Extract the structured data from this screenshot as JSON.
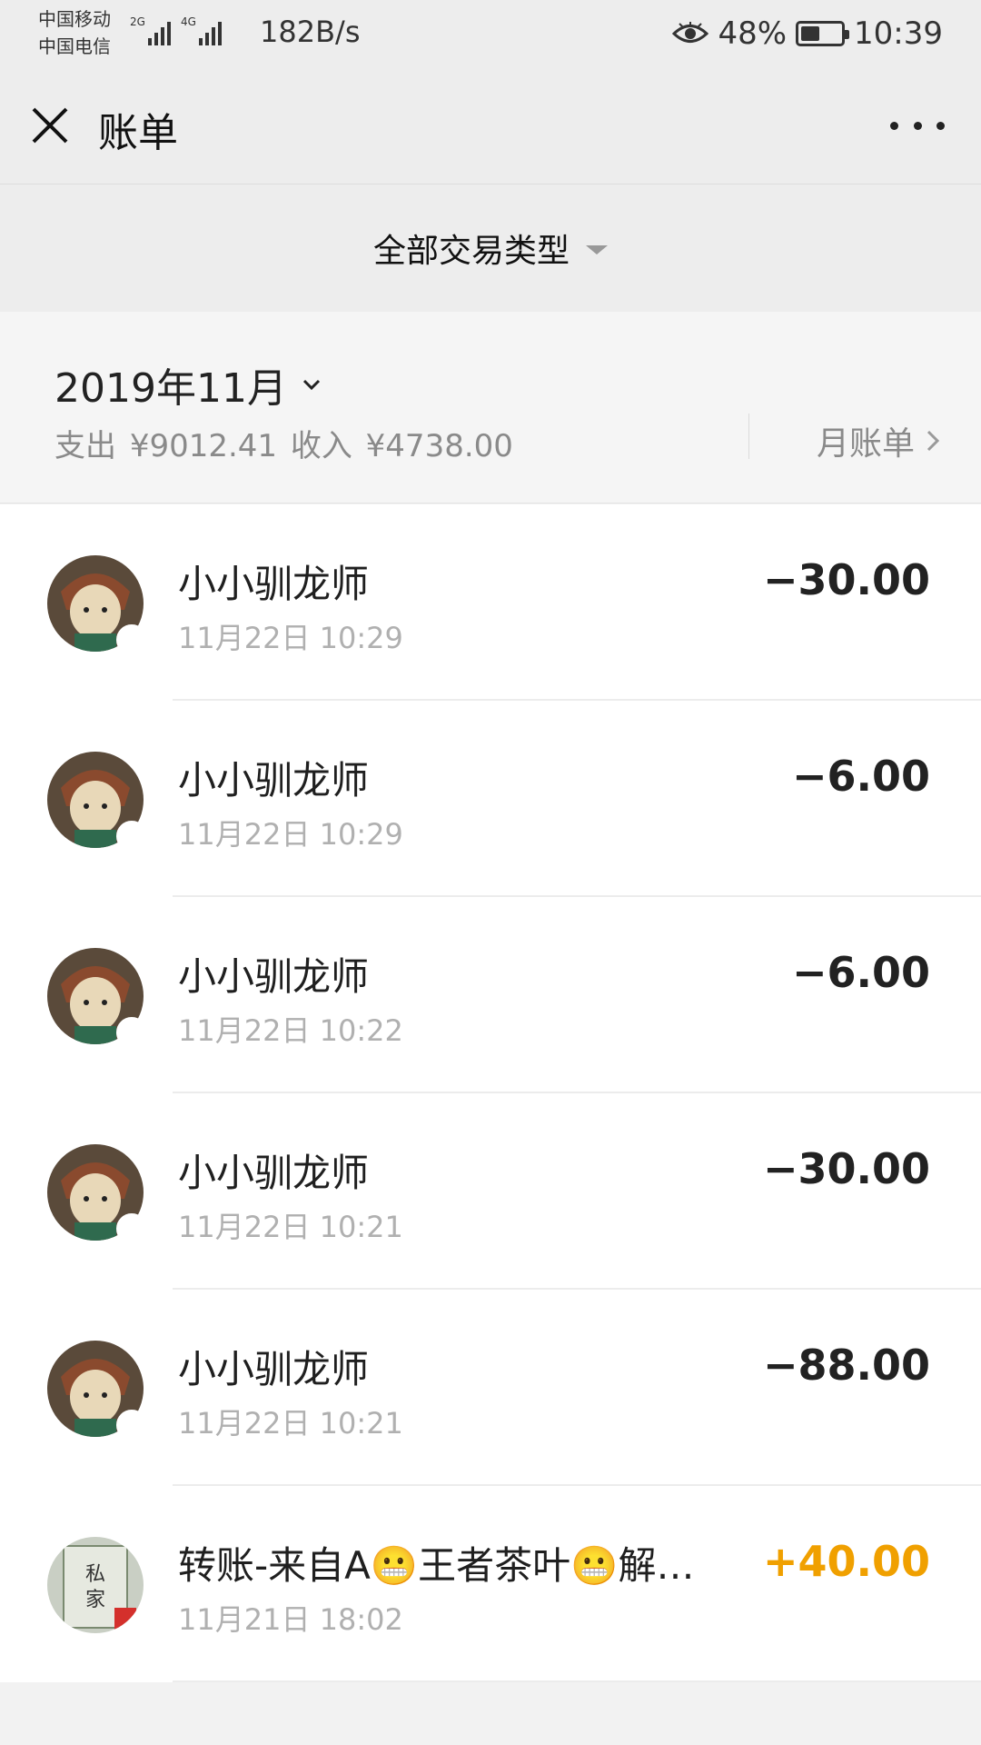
{
  "status_bar": {
    "carrier1": "中国移动",
    "carrier2": "中国电信",
    "net1": "2G",
    "net2": "4G",
    "speed": "182B/s",
    "battery_percent": "48%",
    "battery_level": 0.48,
    "time": "10:39"
  },
  "nav": {
    "title": "账单"
  },
  "filter": {
    "label": "全部交易类型"
  },
  "month": {
    "title": "2019年11月",
    "expense_label": "支出",
    "expense_value": "¥9012.41",
    "income_label": "收入",
    "income_value": "¥4738.00",
    "monthly_bill_label": "月账单"
  },
  "transactions": [
    {
      "name": "小小驯龙师",
      "time": "11月22日 10:29",
      "amount": "−30.00",
      "type": "expense"
    },
    {
      "name": "小小驯龙师",
      "time": "11月22日 10:29",
      "amount": "−6.00",
      "type": "expense"
    },
    {
      "name": "小小驯龙师",
      "time": "11月22日 10:22",
      "amount": "−6.00",
      "type": "expense"
    },
    {
      "name": "小小驯龙师",
      "time": "11月22日 10:21",
      "amount": "−30.00",
      "type": "expense"
    },
    {
      "name": "小小驯龙师",
      "time": "11月22日 10:21",
      "amount": "−88.00",
      "type": "expense"
    },
    {
      "name": "转账-来自A😬王者茶叶😬解…",
      "time": "11月21日 18:02",
      "amount": "+40.00",
      "type": "income"
    }
  ],
  "colors": {
    "income": "#f0a000",
    "expense": "#222222",
    "background": "#ededed"
  }
}
